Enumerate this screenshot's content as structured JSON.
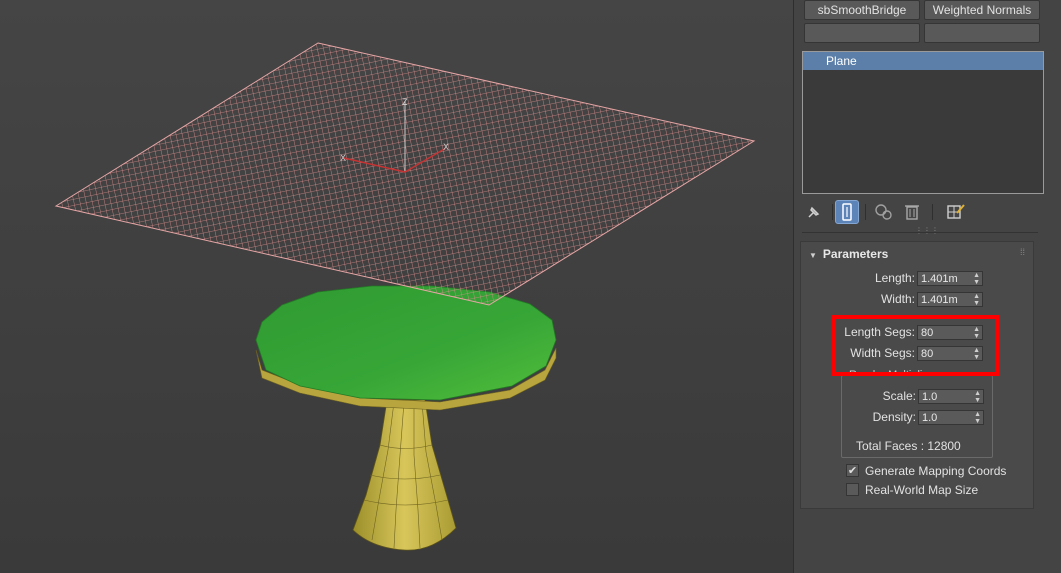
{
  "modifier_buttons": [
    "sbSmoothBridge",
    "Weighted Normals",
    "",
    ""
  ],
  "modifier_stack": {
    "items": [
      {
        "label": "Plane",
        "selected": true
      }
    ]
  },
  "stack_tools": [
    {
      "icon": "pin-stack-icon"
    },
    {
      "icon": "show-end-result-icon",
      "active": true
    },
    {
      "icon": "make-unique-icon"
    },
    {
      "icon": "remove-modifier-icon"
    },
    {
      "icon": "configure-modifier-sets-icon"
    }
  ],
  "parameters": {
    "title": "Parameters",
    "length": {
      "label": "Length:",
      "value": "1.401m"
    },
    "width": {
      "label": "Width:",
      "value": "1.401m"
    },
    "length_segs": {
      "label": "Length Segs:",
      "value": "80"
    },
    "width_segs": {
      "label": "Width Segs:",
      "value": "80"
    },
    "render_multipliers": {
      "title": "Render Multipliers",
      "scale": {
        "label": "Scale:",
        "value": "1.0"
      },
      "density": {
        "label": "Density:",
        "value": "1.0"
      },
      "total_faces": "Total Faces : 12800"
    },
    "generate_mapping": {
      "label": "Generate Mapping Coords",
      "checked": true
    },
    "real_world": {
      "label": "Real-World Map Size",
      "checked": false
    }
  },
  "gizmo_axes": {
    "z": "Z",
    "x_left": "X",
    "x_right": "X"
  },
  "colors": {
    "selection": "#5c7fa9",
    "highlight_box": "#ff0000",
    "table_top": "#3fae3f",
    "table_base": "#c8b74a",
    "plane_wire": "#d98c8c"
  }
}
